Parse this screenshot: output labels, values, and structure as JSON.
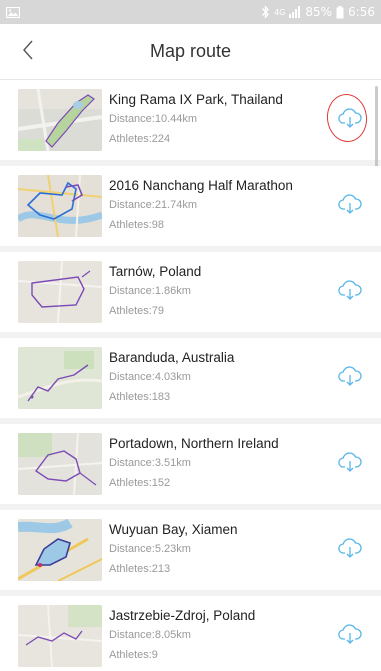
{
  "status_bar": {
    "left_icon": "image-notification-icon",
    "bluetooth_icon": "bluetooth-icon",
    "network_label": "4G",
    "signal_icon": "signal-icon",
    "battery_percent": "85%",
    "battery_icon": "battery-icon",
    "time": "6:56"
  },
  "header": {
    "back_icon": "chevron-left-icon",
    "title": "Map route"
  },
  "routes": [
    {
      "name": "King Rama IX Park, Thailand",
      "distance": "Distance:10.44km",
      "athletes": "Athletes:224",
      "icon": "cloud-download-icon",
      "highlighted": true
    },
    {
      "name": "2016 Nanchang Half Marathon",
      "distance": "Distance:21.74km",
      "athletes": "Athletes:98",
      "icon": "cloud-download-icon"
    },
    {
      "name": "Tarnów, Poland",
      "distance": "Distance:1.86km",
      "athletes": "Athletes:79",
      "icon": "cloud-download-icon"
    },
    {
      "name": "Baranduda, Australia",
      "distance": "Distance:4.03km",
      "athletes": "Athletes:183",
      "icon": "cloud-download-icon"
    },
    {
      "name": "Portadown, Northern Ireland",
      "distance": "Distance:3.51km",
      "athletes": "Athletes:152",
      "icon": "cloud-download-icon"
    },
    {
      "name": "Wuyuan Bay, Xiamen",
      "distance": "Distance:5.23km",
      "athletes": "Athletes:213",
      "icon": "cloud-download-icon"
    },
    {
      "name": "Jastrzebie-Zdroj, Poland",
      "distance": "Distance:8.05km",
      "athletes": "Athletes:9",
      "icon": "cloud-download-icon"
    }
  ],
  "colors": {
    "accent": "#58b6e8",
    "annotation": "#e03a3a",
    "route_line": "#7c4bb6"
  }
}
